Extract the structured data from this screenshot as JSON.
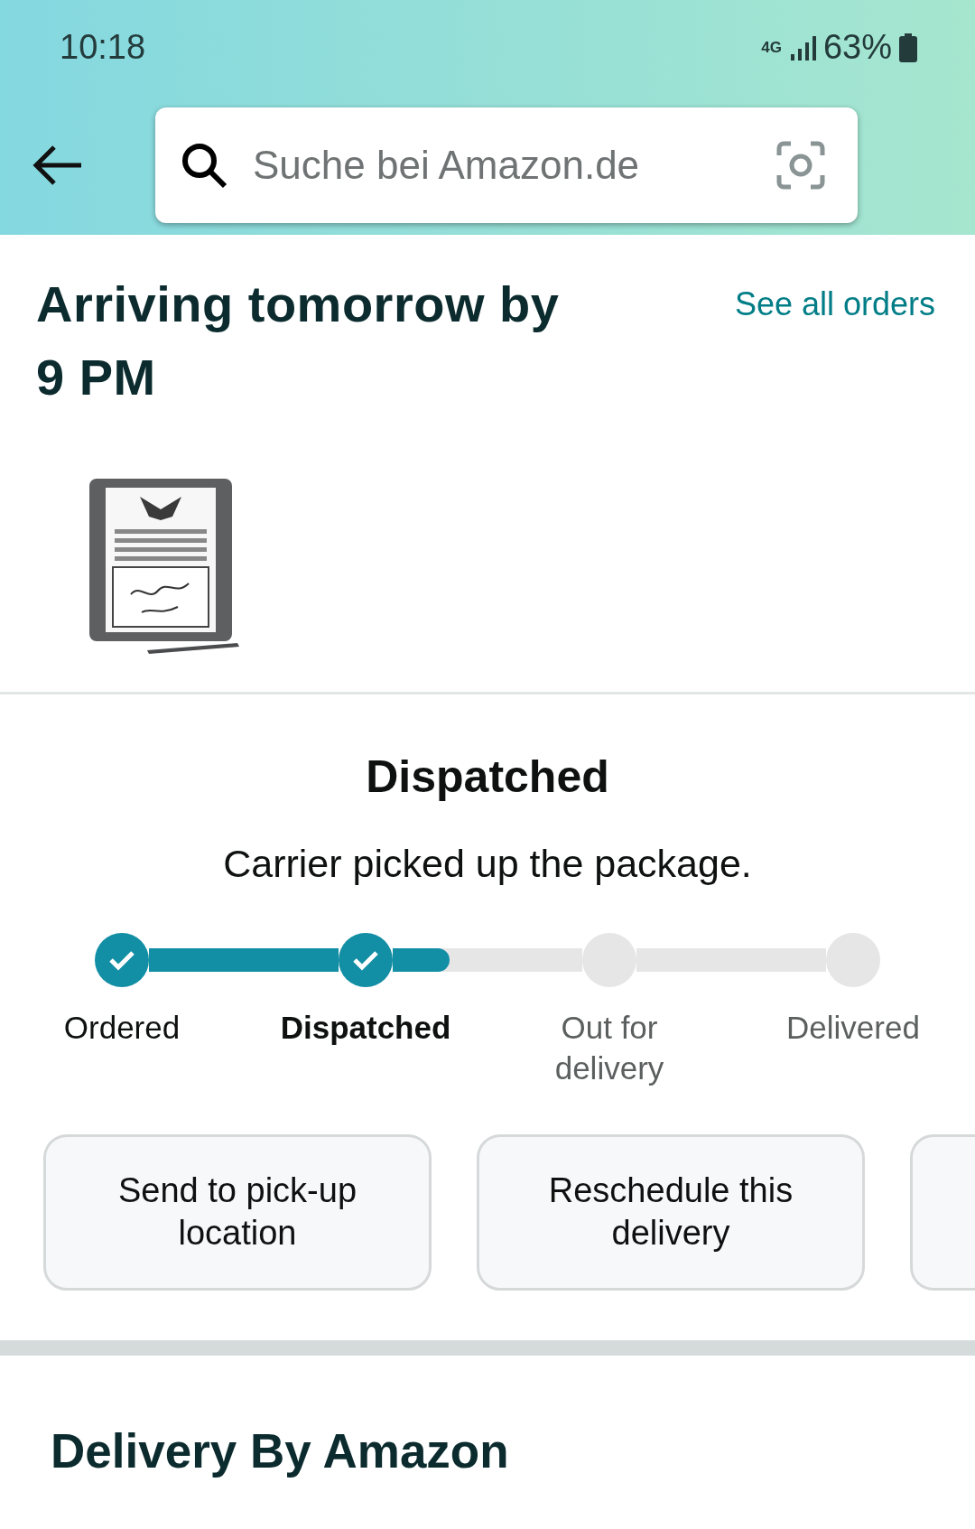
{
  "status_bar": {
    "time": "10:18",
    "network": "4G",
    "battery": "63%"
  },
  "search": {
    "placeholder": "Suche bei Amazon.de"
  },
  "heading": "Arriving tomorrow by 9 PM",
  "see_all_link": "See all orders",
  "status": {
    "title": "Dispatched",
    "subtitle": "Carrier picked up the package."
  },
  "tracker": {
    "steps": [
      {
        "label": "Ordered",
        "completed": true,
        "selected": false
      },
      {
        "label": "Dispatched",
        "completed": true,
        "selected": true
      },
      {
        "label": "Out for delivery",
        "completed": false,
        "selected": false
      },
      {
        "label": "Delivered",
        "completed": false,
        "selected": false
      }
    ]
  },
  "buttons": [
    {
      "kind": "action",
      "label": "Send to pick-up location"
    },
    {
      "kind": "action",
      "label": "Reschedule this delivery"
    },
    {
      "kind": "partial"
    }
  ],
  "section_title": "Delivery By Amazon"
}
